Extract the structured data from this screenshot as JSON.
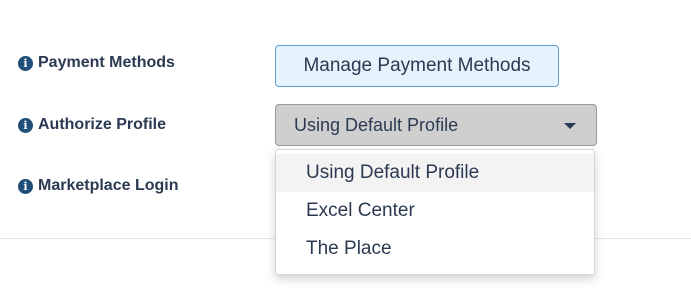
{
  "fields": {
    "payment_methods": {
      "label": "Payment Methods",
      "button_label": "Manage Payment Methods"
    },
    "authorize_profile": {
      "label": "Authorize Profile",
      "selected": "Using Default Profile"
    },
    "marketplace_login": {
      "label": "Marketplace Login"
    }
  },
  "dropdown": {
    "options": [
      "Using Default Profile",
      "Excel Center",
      "The Place"
    ],
    "highlighted_index": 0
  },
  "icons": {
    "info": "info-circle-icon",
    "caret": "caret-down-icon"
  },
  "colors": {
    "label_text": "#2b3a52",
    "info_icon": "#1f4e79",
    "button_bg": "#e6f3fc",
    "button_border": "#5aa0d8",
    "select_bg": "#cfcfcf"
  }
}
